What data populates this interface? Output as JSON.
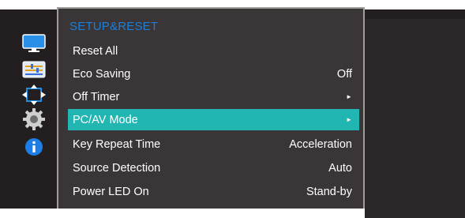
{
  "menu": {
    "title": "SETUP&RESET",
    "items": [
      {
        "label": "Reset All",
        "value": ""
      },
      {
        "label": "Eco Saving",
        "value": "Off"
      },
      {
        "label": "Off Timer",
        "value": "►"
      },
      {
        "label": "PC/AV Mode",
        "value": "►",
        "active": true
      },
      {
        "label": "Key Repeat Time",
        "value": "Acceleration"
      },
      {
        "label": "Source Detection",
        "value": "Auto"
      },
      {
        "label": "Power LED On",
        "value": "Stand-by"
      }
    ]
  },
  "sidebar": {
    "icons": [
      "monitor-icon",
      "picture-adjust-icon",
      "screen-size-icon",
      "gear-icon",
      "info-icon"
    ]
  },
  "colors": {
    "background": "#231f20",
    "panel": "#3a3536",
    "highlight": "#21b6b1",
    "title": "#1d7fd8"
  }
}
